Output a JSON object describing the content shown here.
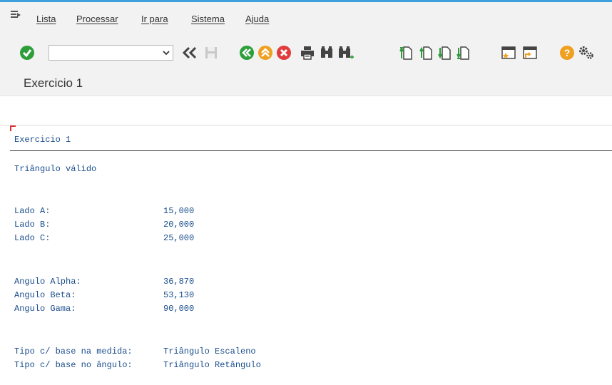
{
  "menu": {
    "items": [
      "Lista",
      "Processar",
      "Ir para",
      "Sistema",
      "Ajuda"
    ]
  },
  "toolbar": {
    "command_value": "",
    "icons": [
      "enter-icon",
      "dropdown-icon",
      "back-double-icon",
      "save-icon",
      "back-icon",
      "exit-icon",
      "cancel-icon",
      "print-icon",
      "find-icon",
      "find-next-icon",
      "first-page-icon",
      "previous-page-icon",
      "next-page-icon",
      "last-page-icon",
      "create-session-icon",
      "shortcut-icon",
      "help-icon",
      "settings-icon"
    ]
  },
  "page": {
    "title": "Exercicio 1"
  },
  "report": {
    "heading": "Exercicio 1",
    "status": "Triângulo válido",
    "sides": [
      {
        "label": "Lado A:",
        "value": "15,000"
      },
      {
        "label": "Lado B:",
        "value": "20,000"
      },
      {
        "label": "Lado C:",
        "value": "25,000"
      }
    ],
    "angles": [
      {
        "label": "Angulo Alpha:",
        "value": "36,870"
      },
      {
        "label": "Angulo Beta:",
        "value": "53,130"
      },
      {
        "label": "Angulo Gama:",
        "value": "90,000"
      }
    ],
    "type_measure": {
      "label": "Tipo c/ base na medida:",
      "value": "Triângulo Escaleno"
    },
    "type_angle": {
      "label": "Tipo c/ base no ângulo:",
      "value": "Triângulo Retângulo"
    }
  },
  "colors": {
    "accent": "#3ea0dc",
    "text_blue": "#1a4d8c",
    "green": "#2e9e3a",
    "orange": "#f0a020",
    "red": "#e03c3c"
  }
}
